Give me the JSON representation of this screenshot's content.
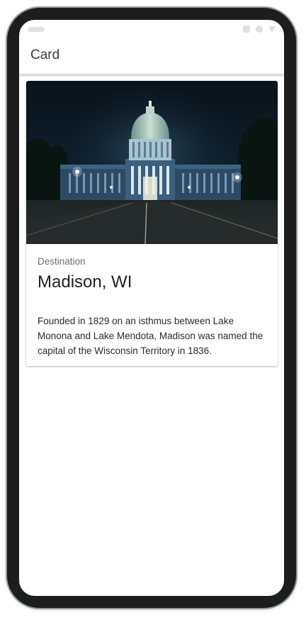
{
  "app_bar": {
    "title": "Card"
  },
  "card": {
    "image": "madison-capitol-night-photo",
    "overline": "Destination",
    "title": "Madison, WI",
    "body": "Founded in 1829 on an isthmus between Lake Monona and Lake Mendota, Madison was named the capital of the Wisconsin Territory in 1836."
  },
  "colors": {
    "phone_frame": "#1c1d1f",
    "screen_bg": "#ffffff",
    "sky": "#0c1620",
    "capitol_lit": "#9fb8c8"
  },
  "icons": [
    "status-pill-icon",
    "status-square-icon",
    "status-circle-icon",
    "status-triangle-icon"
  ]
}
